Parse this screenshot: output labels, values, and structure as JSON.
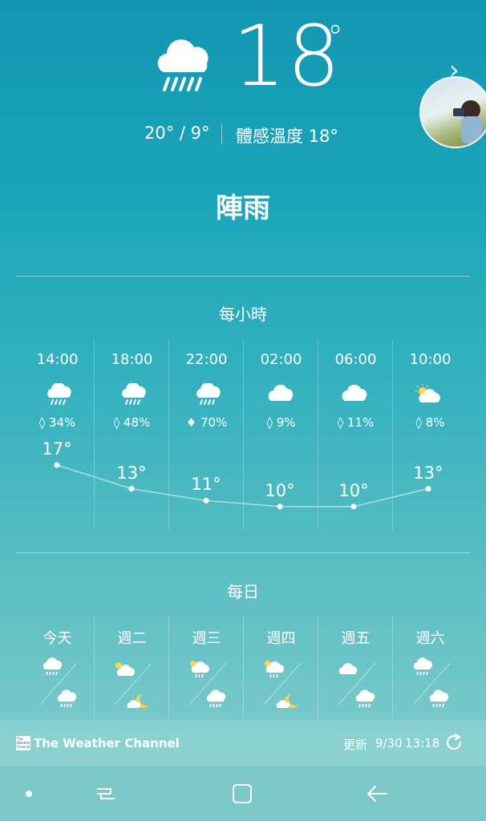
{
  "current": {
    "temperature": "18",
    "degree_symbol": "°",
    "icon": "rain-cloud-icon",
    "high_low": "20° / 9°",
    "feels_like": "體感溫度 18°",
    "condition": "陣雨"
  },
  "hourly": {
    "title": "每小時",
    "items": [
      {
        "time": "14:00",
        "icon": "rain",
        "pop": "34%",
        "temp": "17°",
        "temp_value": 17
      },
      {
        "time": "18:00",
        "icon": "rain",
        "pop": "48%",
        "temp": "13°",
        "temp_value": 13
      },
      {
        "time": "22:00",
        "icon": "rain",
        "pop": "70%",
        "temp": "11°",
        "temp_value": 11
      },
      {
        "time": "02:00",
        "icon": "cloud",
        "pop": "9%",
        "temp": "10°",
        "temp_value": 10
      },
      {
        "time": "06:00",
        "icon": "cloud",
        "pop": "11%",
        "temp": "10°",
        "temp_value": 10
      },
      {
        "time": "10:00",
        "icon": "partly-sunny",
        "pop": "8%",
        "temp": "13°",
        "temp_value": 13
      }
    ]
  },
  "daily": {
    "title": "每日",
    "items": [
      {
        "day": "今天",
        "day_icon": "rain",
        "night_icon": "rain"
      },
      {
        "day": "週二",
        "day_icon": "partly-sunny",
        "night_icon": "cloudy-moon"
      },
      {
        "day": "週三",
        "day_icon": "sun-rain",
        "night_icon": "rain"
      },
      {
        "day": "週四",
        "day_icon": "sun-rain",
        "night_icon": "cloudy-moon"
      },
      {
        "day": "週五",
        "day_icon": "cloud",
        "night_icon": "rain"
      },
      {
        "day": "週六",
        "day_icon": "rain",
        "night_icon": "rain"
      }
    ]
  },
  "footer": {
    "provider": "The Weather Channel",
    "logo_text": "The Weather Channel",
    "update_label": "更新",
    "update_date": "9/30",
    "update_time": "13:18"
  },
  "nav": {
    "icons": [
      "dot-icon",
      "recent-apps-icon",
      "home-icon",
      "back-icon"
    ]
  }
}
